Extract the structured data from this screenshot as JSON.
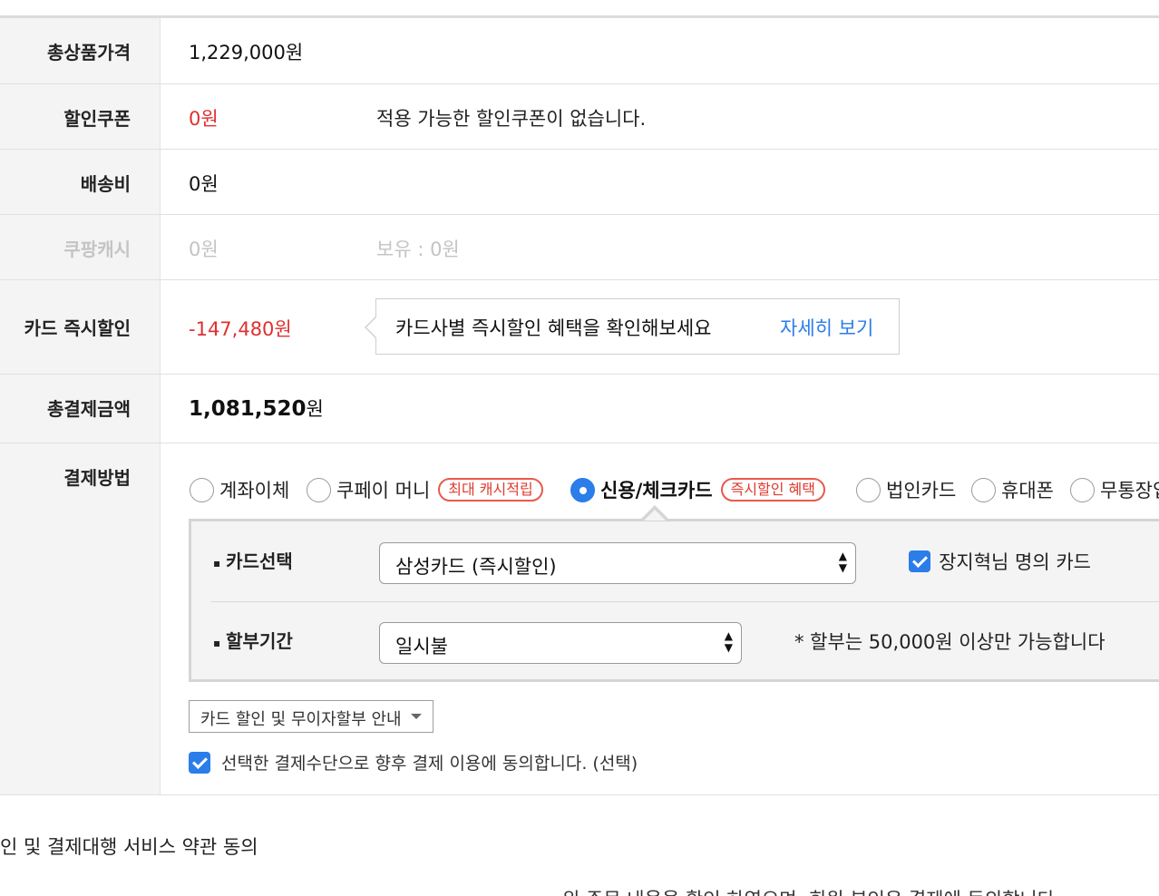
{
  "rows": {
    "total_price": {
      "label": "총상품가격",
      "value": "1,229,000원"
    },
    "coupon": {
      "label": "할인쿠폰",
      "value": "0원",
      "note": "적용 가능한 할인쿠폰이 없습니다."
    },
    "shipping": {
      "label": "배송비",
      "value": "0원"
    },
    "cash": {
      "label": "쿠팡캐시",
      "value": "0원",
      "note": "보유 : 0원"
    },
    "card_discount": {
      "label": "카드 즉시할인",
      "value": "-147,480원",
      "tip_text": "카드사별 즉시할인 혜택을 확인해보세요",
      "tip_link": "자세히 보기"
    },
    "total_pay": {
      "label": "총결제금액",
      "value_num": "1,081,520",
      "value_unit": "원"
    },
    "method": {
      "label": "결제방법"
    }
  },
  "payment_methods": [
    {
      "label": "계좌이체",
      "selected": false
    },
    {
      "label": "쿠페이 머니",
      "badge": "최대 캐시적립",
      "selected": false
    },
    {
      "label": "신용/체크카드",
      "badge": "즉시할인 혜택",
      "selected": true
    },
    {
      "label": "법인카드",
      "selected": false
    },
    {
      "label": "휴대폰",
      "selected": false
    },
    {
      "label": "무통장입금",
      "selected": false
    }
  ],
  "card_panel": {
    "card_select_label": "카드선택",
    "card_select_value": "삼성카드 (즉시할인)",
    "owner_check_label": "장지혁님 명의 카드",
    "installment_label": "할부기간",
    "installment_value": "일시불",
    "installment_note": "* 할부는 50,000원 이상만 가능합니다"
  },
  "guide_dropdown": "카드 할인 및 무이자할부 안내",
  "agree_text": "선택한 결제수단으로 향후 결제 이용에 동의합니다. (선택)",
  "terms_title": "인 및 결제대행 서비스 약관 동의",
  "bottom_text": "위 주문 내용을 확인 하였으며, 회원 본인은 결제에 동의합니다."
}
